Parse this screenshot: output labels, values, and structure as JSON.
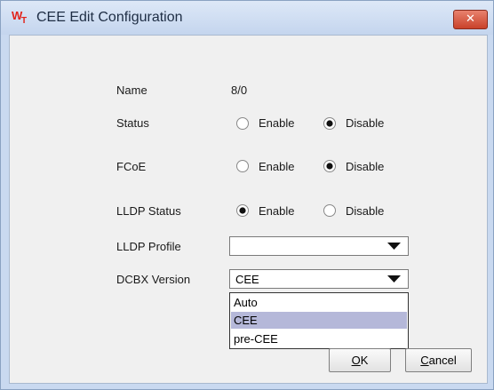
{
  "window": {
    "title": "CEE Edit Configuration",
    "close_symbol": "✕"
  },
  "form": {
    "name": {
      "label": "Name",
      "value": "8/0"
    },
    "status": {
      "label": "Status",
      "enable_label": "Enable",
      "disable_label": "Disable",
      "selected": "Disable"
    },
    "fcoe": {
      "label": "FCoE",
      "enable_label": "Enable",
      "disable_label": "Disable",
      "selected": "Disable"
    },
    "lldp_status": {
      "label": "LLDP Status",
      "enable_label": "Enable",
      "disable_label": "Disable",
      "selected": "Enable"
    },
    "lldp_profile": {
      "label": "LLDP Profile",
      "value": ""
    },
    "dcbx_version": {
      "label": "DCBX Version",
      "value": "CEE",
      "options": [
        "Auto",
        "CEE",
        "pre-CEE"
      ],
      "highlighted": "CEE"
    }
  },
  "buttons": {
    "ok": {
      "mnemonic": "O",
      "rest": "K"
    },
    "cancel": {
      "mnemonic": "C",
      "rest": "ancel"
    }
  },
  "colors": {
    "title_bar": "#c4d5ee",
    "close_button": "#c9422a",
    "highlight": "#b5b8d9",
    "logo": "#e2231a"
  },
  "icons": [
    "app-logo-icon",
    "close-icon",
    "chevron-down-icon",
    "radio-icon"
  ]
}
